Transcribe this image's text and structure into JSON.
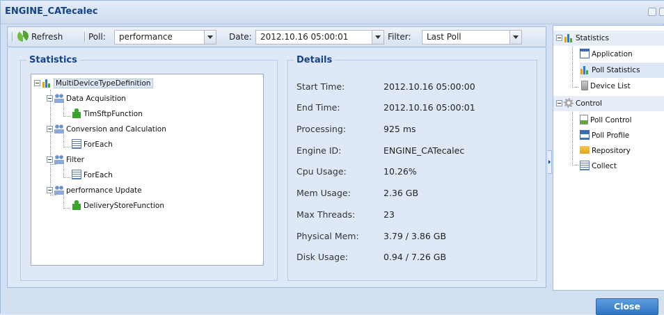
{
  "window": {
    "title": "ENGINE_CATecalec"
  },
  "toolbar": {
    "refresh_label": "Refresh",
    "poll_label": "Poll:",
    "poll_value": "performance",
    "date_label": "Date:",
    "date_value": "2012.10.16 05:00:01",
    "filter_label": "Filter:",
    "filter_value": "Last Poll"
  },
  "statistics": {
    "legend": "Statistics",
    "tree": [
      {
        "label": "MultiDeviceTypeDefinition",
        "icon": "chart-icon"
      },
      {
        "label": "Data Acquisition",
        "icon": "people-icon"
      },
      {
        "label": "TimSftpFunction",
        "icon": "puzzle-icon"
      },
      {
        "label": "Conversion and Calculation",
        "icon": "people-icon"
      },
      {
        "label": "ForEach",
        "icon": "list-icon"
      },
      {
        "label": "Filter",
        "icon": "people-icon"
      },
      {
        "label": "ForEach",
        "icon": "list-icon"
      },
      {
        "label": "performance Update",
        "icon": "people-icon"
      },
      {
        "label": "DeliveryStoreFunction",
        "icon": "puzzle-icon"
      }
    ]
  },
  "details": {
    "legend": "Details",
    "rows": [
      {
        "label": "Start Time:",
        "value": "2012.10.16 05:00:00"
      },
      {
        "label": "End Time:",
        "value": "2012.10.16 05:00:01"
      },
      {
        "label": "Processing:",
        "value": "925 ms"
      },
      {
        "label": "Engine ID:",
        "value": "ENGINE_CATecalec"
      },
      {
        "label": "Cpu Usage:",
        "value": "10.26%"
      },
      {
        "label": "Mem Usage:",
        "value": "2.36 GB"
      },
      {
        "label": "Max Threads:",
        "value": "23"
      },
      {
        "label": "Physical Mem:",
        "value": "3.79 / 3.86 GB"
      },
      {
        "label": "Disk Usage:",
        "value": "0.94 / 7.26 GB"
      }
    ]
  },
  "nav": {
    "statistics": "Statistics",
    "application": "Application",
    "poll_statistics": "Poll Statistics",
    "device_list": "Device List",
    "control": "Control",
    "poll_control": "Poll Control",
    "poll_profile": "Poll Profile",
    "repository": "Repository",
    "collect": "Collect"
  },
  "footer": {
    "close_label": "Close"
  },
  "colors": {
    "accent": "#15428b",
    "selection": "#dfe8f6",
    "button": "#2f74c6"
  }
}
